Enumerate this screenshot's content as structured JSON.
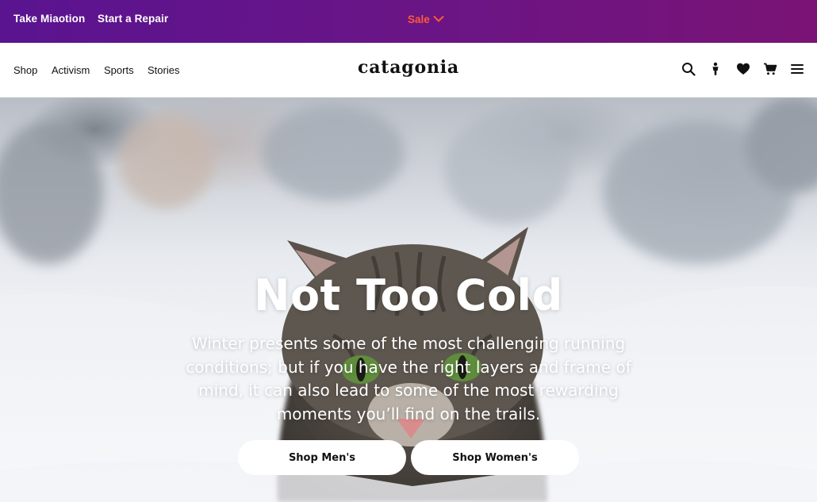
{
  "promo_bar": {
    "links": [
      "Take Miaotion",
      "Start a Repair"
    ],
    "sale_label": "Sale",
    "sale_icon": "chevron-down-icon",
    "sale_color": "#ff5a36",
    "background_color": "#6b1585"
  },
  "nav": {
    "links": [
      "Shop",
      "Activism",
      "Sports",
      "Stories"
    ],
    "logo": "catagonia",
    "icons": [
      "search-icon",
      "person-icon",
      "heart-icon",
      "cart-icon",
      "menu-icon"
    ]
  },
  "hero": {
    "title": "Not Too Cold",
    "body": "Winter presents some of the most challenging running conditions; but if you have the right layers and frame of mind, it can also lead to some of the most rewarding moments you’ll find on the trails.",
    "buttons": [
      "Shop Men's",
      "Shop Women's"
    ]
  }
}
